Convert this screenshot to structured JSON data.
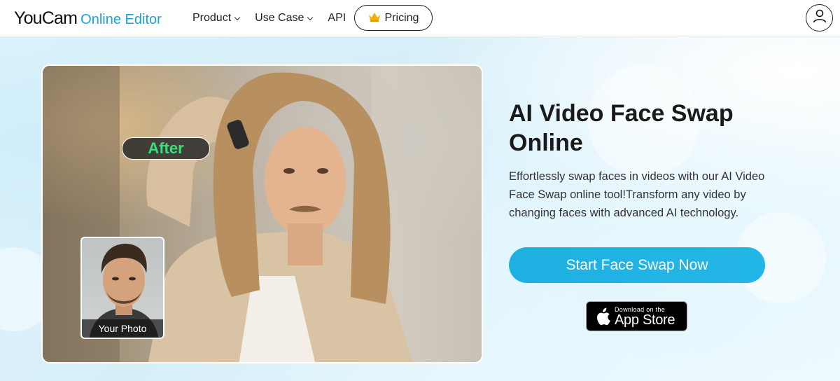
{
  "header": {
    "logo_main": "YouCam",
    "logo_sub": "Online Editor",
    "nav": [
      {
        "label": "Product",
        "has_dropdown": true
      },
      {
        "label": "Use Case",
        "has_dropdown": true
      },
      {
        "label": "API",
        "has_dropdown": false
      }
    ],
    "pricing_label": "Pricing",
    "pricing_icon": "crown-icon",
    "account_icon": "user-icon"
  },
  "hero": {
    "after_label": "After",
    "your_photo_label": "Your Photo",
    "title": "AI Video Face Swap Online",
    "description": "Effortlessly swap faces in videos with our AI Video Face Swap online tool!Transform any video by changing faces with advanced AI technology.",
    "cta_label": "Start Face Swap Now",
    "appstore_small": "Download on the",
    "appstore_big": "App Store",
    "appstore_icon": "apple-icon"
  },
  "colors": {
    "brand": "#1aa3d9",
    "cta": "#1fb0e2",
    "after_text": "#39e07a"
  }
}
